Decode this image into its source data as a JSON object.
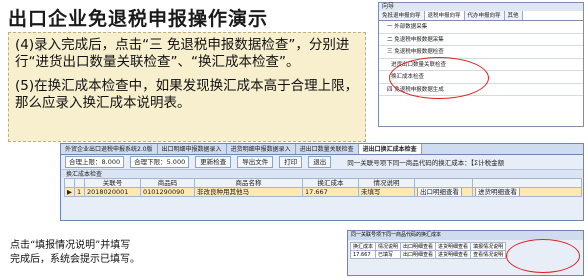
{
  "title": "出口企业免退税申报操作演示",
  "instructions": {
    "p1": "(4)录入完成后，点击“三 免退税申报数据检查”，分别进行“进货出口数量关联检查”、“换汇成本检查”。",
    "p2": "(5)在换汇成本检查中，如果发现换汇成本高于合理上限，那么应录入换汇成本说明表。"
  },
  "wizard": {
    "title": "向导",
    "tabs": [
      "免抵退申报向导",
      "退税申报向导",
      "代办申报向导",
      "其他"
    ],
    "items": [
      "一 外部数据采集",
      "二 免退税申报数据采集",
      "三 免退税申报数据检查",
      "进货出口数量关联检查",
      "换汇成本检查",
      "四 免退税申报数据生成"
    ]
  },
  "app": {
    "tabs": [
      "外贸企业出口退税申报系统2.0版",
      "出口明细申报数据录入",
      "进货明细申报数据录入",
      "进出口数量关联检查",
      "进出口换汇成本检查"
    ],
    "active_tab_index": 4,
    "toolbar": {
      "upper_limit": "合理上限：8.000",
      "lower_limit": "合理下限：5.000",
      "btn_refresh": "更新检查",
      "btn_export": "导出文件",
      "btn_print": "打印",
      "btn_exit": "退出",
      "note": "同一关联号项下同一商品代码的换汇成本：【Σ计税金额"
    },
    "subheader": "换汇成本检查",
    "columns": [
      "",
      "",
      "关联号",
      "商品码",
      "商品名称",
      "换汇成本",
      "情况说明",
      "",
      ""
    ],
    "rows": [
      [
        "▶",
        "1",
        "2018020001",
        "0101290090",
        "非改良种用其他马",
        "17.667",
        "未填写",
        "出口明细查看",
        "进货明细查看"
      ]
    ]
  },
  "note": {
    "line1": "点击“填报情况说明”并填写",
    "line2": "完成后，系统会提示已填写。"
  },
  "thumb": {
    "bar": "同一关联号项下同一商品代码的换汇成本",
    "cells": [
      "换汇成本",
      "情况说明",
      "出口明细查看",
      "进货明细查看",
      "填报情况说明",
      "17.667",
      "已填写",
      "出口明细查看",
      "进货明细查看",
      "查看情况说明"
    ]
  }
}
